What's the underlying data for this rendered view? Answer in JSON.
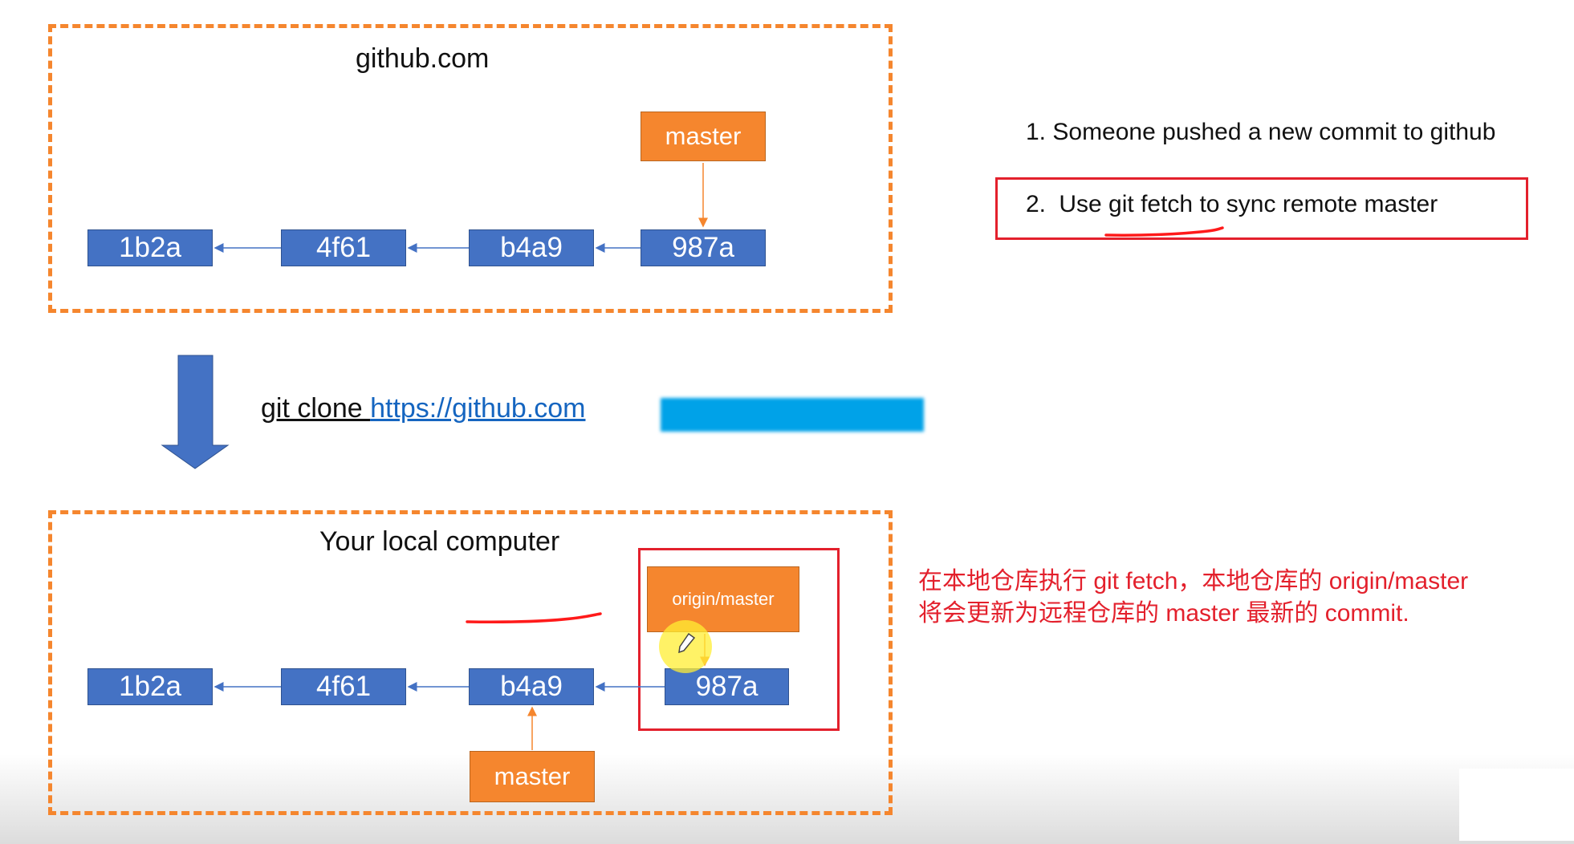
{
  "colors": {
    "commit_fill": "#4472c4",
    "branch_fill": "#f5862e",
    "dash_border": "#f5862e",
    "annotation_red": "#e3202c",
    "link_blue": "#1565c0",
    "redacted_blue": "#00a2e8"
  },
  "remote": {
    "title": "github.com",
    "commits": [
      "1b2a",
      "4f61",
      "b4a9",
      "987a"
    ],
    "branch_label": "master",
    "branch_points_to": "987a"
  },
  "clone": {
    "command": "git clone ",
    "url": "https://github.com",
    "url_redacted": true,
    "arrow_icon": "down-arrow-icon"
  },
  "local": {
    "title": "Your local computer",
    "commits": [
      "1b2a",
      "4f61",
      "b4a9",
      "987a"
    ],
    "origin_branch_label": "origin/master",
    "origin_points_to": "987a",
    "branch_label": "master",
    "branch_points_to": "b4a9",
    "cursor_icon": "pen-cursor-icon"
  },
  "steps": [
    {
      "number": "1.",
      "text": "Someone pushed a new commit to github"
    },
    {
      "number": "2.",
      "text": "Use git fetch to sync remote master",
      "highlighted": true
    }
  ],
  "note": {
    "line1": "在本地仓库执行 git fetch，本地仓库的 origin/master",
    "line2": "将会更新为远程仓库的 master 最新的 commit."
  }
}
